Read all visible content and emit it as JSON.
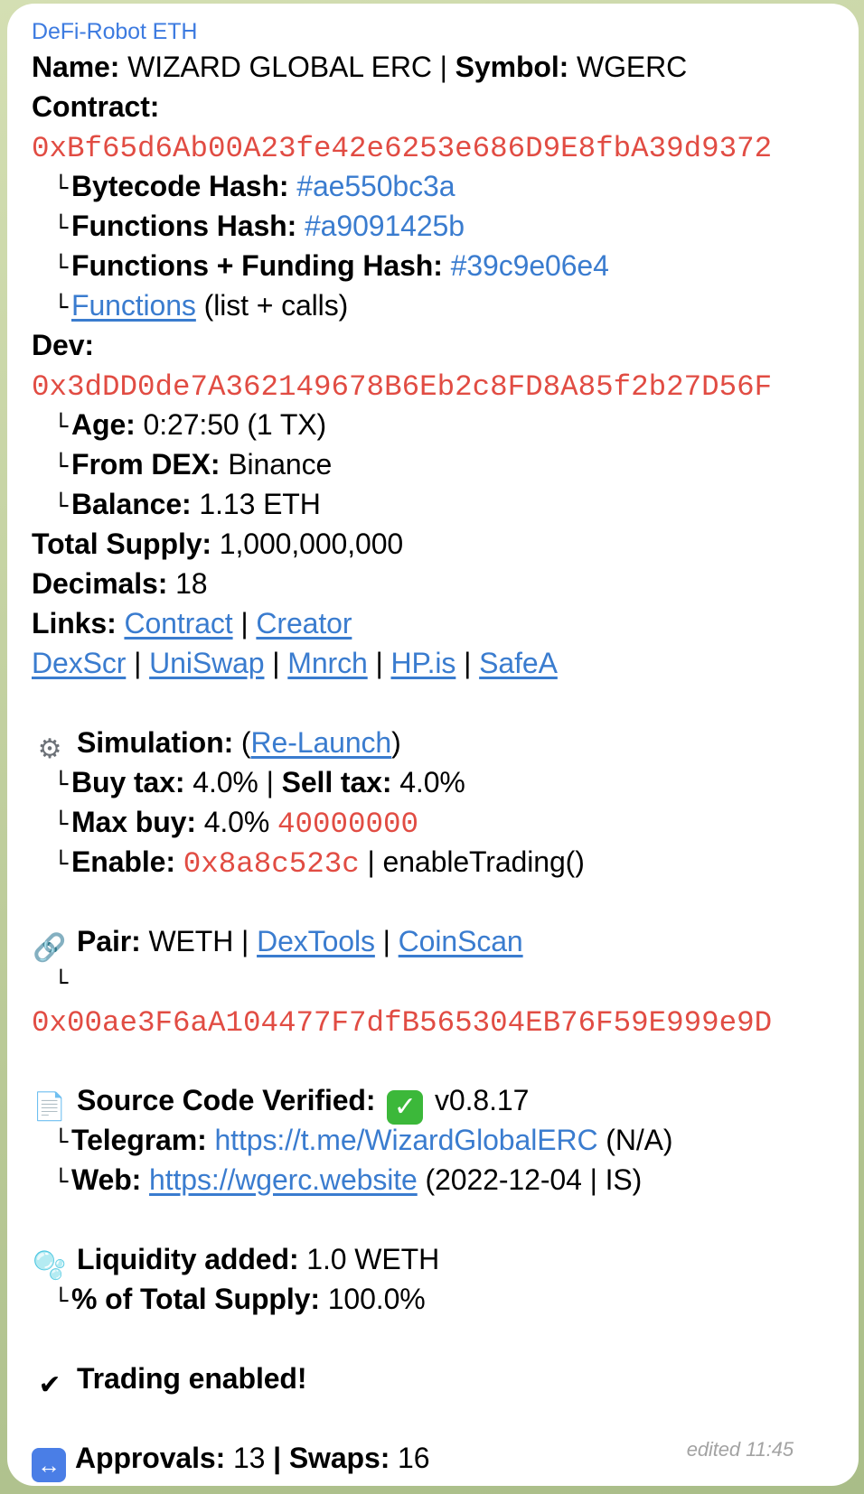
{
  "sender": "DeFi-Robot ETH",
  "name_label": "Name:",
  "name_value": "WIZARD GLOBAL ERC",
  "symbol_label": "Symbol:",
  "symbol_value": "WGERC",
  "contract_label": "Contract:",
  "contract_address": "0xBf65d6Ab00A23fe42e6253e686D9E8fbA39d9372",
  "bytecode_label": "Bytecode Hash:",
  "bytecode_value": "#ae550bc3a",
  "functions_hash_label": "Functions Hash:",
  "functions_hash_value": "#a9091425b",
  "funding_hash_label": "Functions + Funding Hash:",
  "funding_hash_value": "#39c9e06e4",
  "functions_link": "Functions",
  "functions_suffix": "(list + calls)",
  "dev_label": "Dev:",
  "dev_address": "0x3dDD0de7A362149678B6Eb2c8FD8A85f2b27D56F",
  "age_label": "Age:",
  "age_value": "0:27:50 (1 TX)",
  "from_dex_label": "From DEX:",
  "from_dex_value": "Binance",
  "balance_label": "Balance:",
  "balance_value": "1.13 ETH",
  "total_supply_label": "Total Supply:",
  "total_supply_value": "1,000,000,000",
  "decimals_label": "Decimals:",
  "decimals_value": "18",
  "links_label": "Links:",
  "links_row1": [
    "Contract",
    "Creator"
  ],
  "links_row2": [
    "DexScr",
    "UniSwap",
    "Mnrch",
    "HP.is",
    "SafeA"
  ],
  "simulation_label": "Simulation:",
  "relaunch_link": "Re-Launch",
  "buy_tax_label": "Buy tax:",
  "buy_tax_value": "4.0%",
  "sell_tax_label": "Sell tax:",
  "sell_tax_value": "4.0%",
  "max_buy_label": "Max buy:",
  "max_buy_value": "4.0%",
  "max_buy_amount": "40000000",
  "enable_label": "Enable:",
  "enable_selector": "0x8a8c523c",
  "enable_function": "enableTrading()",
  "pair_label": "Pair:",
  "pair_value": "WETH",
  "dextools_link": "DexTools",
  "coinscan_link": "CoinScan",
  "pair_address": "0x00ae3F6aA104477F7dfB565304EB76F59E999e9D",
  "source_label": "Source Code Verified:",
  "source_version": "v0.8.17",
  "telegram_label": "Telegram:",
  "telegram_url": "https://t.me/WizardGlobalERC",
  "telegram_suffix": "(N/A)",
  "web_label": "Web:",
  "web_url": "https://wgerc.website",
  "web_suffix": "(2022-12-04 | IS)",
  "liquidity_label": "Liquidity added:",
  "liquidity_value": "1.0 WETH",
  "pct_supply_label": "% of Total Supply:",
  "pct_supply_value": "100.0%",
  "trading_enabled": "Trading enabled!",
  "approvals_label": "Approvals:",
  "approvals_value": "13",
  "swaps_label": "Swaps:",
  "swaps_value": "16",
  "edited": "edited 11:45",
  "icons": {
    "branch": "└",
    "gear": "⚙",
    "link": "🔗",
    "document": "📄",
    "bubbles": "🫧",
    "checkmark": "✔",
    "check_box": "✓",
    "left_right_arrow": "↔"
  },
  "colors": {
    "address": "#e14c43",
    "link": "#3a7ccf",
    "sender": "#3d7be0",
    "verified_green": "#3cb83a"
  }
}
